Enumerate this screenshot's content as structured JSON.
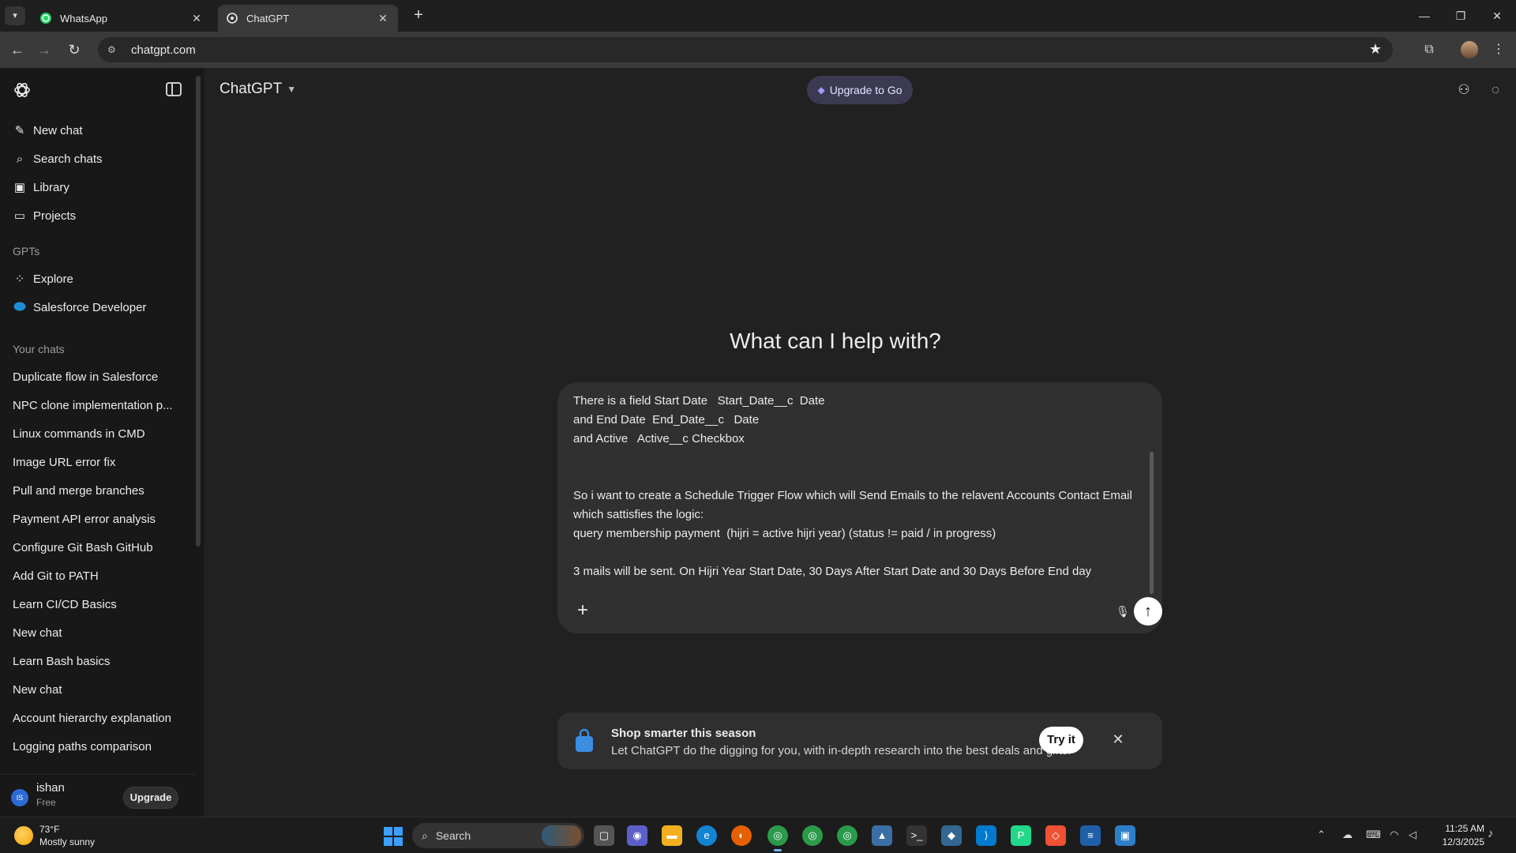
{
  "browser": {
    "tabs": [
      {
        "title": "WhatsApp",
        "icon": "whatsapp-icon",
        "active": false
      },
      {
        "title": "ChatGPT",
        "icon": "chatgpt-icon",
        "active": true
      }
    ],
    "url": "chatgpt.com"
  },
  "sidebar": {
    "primary": [
      {
        "label": "New chat",
        "icon": "new-chat-icon"
      },
      {
        "label": "Search chats",
        "icon": "search-icon"
      },
      {
        "label": "Library",
        "icon": "library-icon"
      },
      {
        "label": "Projects",
        "icon": "folder-icon"
      }
    ],
    "gpts_heading": "GPTs",
    "gpts": [
      {
        "label": "Explore",
        "icon": "grid-icon"
      },
      {
        "label": "Salesforce Developer",
        "icon": "salesforce-icon"
      }
    ],
    "chats_heading": "Your chats",
    "chats": [
      "Duplicate flow in Salesforce",
      "NPC clone implementation p...",
      "Linux commands in CMD",
      "Image URL error fix",
      "Pull and merge branches",
      "Payment API error analysis",
      "Configure Git Bash GitHub",
      "Add Git to PATH",
      "Learn CI/CD Basics",
      "New chat",
      "Learn Bash basics",
      "New chat",
      "Account hierarchy explanation",
      "Logging paths comparison"
    ],
    "user": {
      "initials": "IS",
      "name": "ishan",
      "plan": "Free",
      "upgrade_label": "Upgrade"
    }
  },
  "header": {
    "model": "ChatGPT",
    "upgrade_label": "Upgrade to Go"
  },
  "main": {
    "heading": "What can I help with?",
    "composer_text": "There is a field Start Date   Start_Date__c  Date\nand End Date  End_Date__c   Date\nand Active   Active__c Checkbox\n\n\nSo i want to create a Schedule Trigger Flow which will Send Emails to the relavent Accounts Contact Email\nwhich sattisfies the logic:\nquery membership payment  (hijri = active hijri year) (status != paid / in progress)\n\n3 mails will be sent. On Hijri Year Start Date, 30 Days After Start Date and 30 Days Before End day",
    "promo": {
      "title": "Shop smarter this season",
      "description": "Let ChatGPT do the digging for you, with in-depth research into the best deals and gifts.",
      "cta": "Try it"
    }
  },
  "taskbar": {
    "weather_temp": "73°F",
    "weather_desc": "Mostly sunny",
    "search_label": "Search",
    "time": "11:25 AM",
    "date": "12/3/2025"
  }
}
